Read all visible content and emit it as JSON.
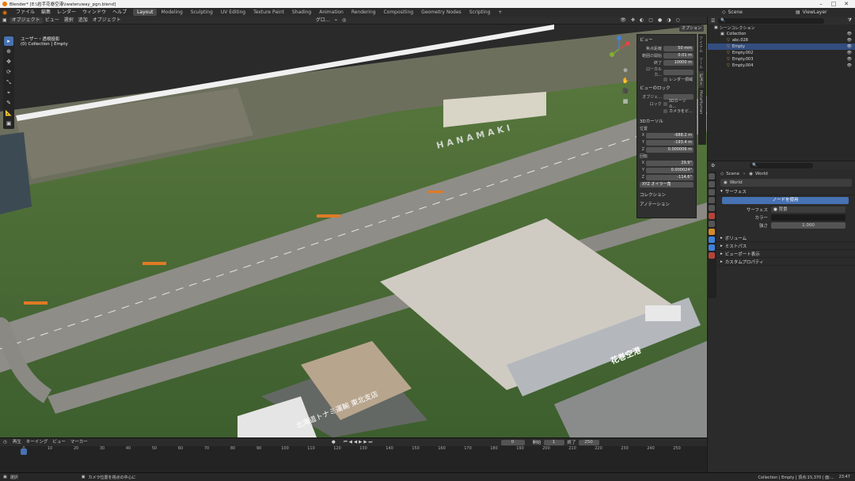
{
  "window": {
    "title": "Blender* [E:\\岩手花巻空港\\iwateruway_pgn.blend]"
  },
  "topmenu": [
    "ファイル",
    "編集",
    "レンダー",
    "ウィンドウ",
    "ヘルプ"
  ],
  "workspaces": [
    "Layout",
    "Modeling",
    "Sculpting",
    "UV Editing",
    "Texture Paint",
    "Shading",
    "Animation",
    "Rendering",
    "Compositing",
    "Geometry Nodes",
    "Scripting"
  ],
  "workspace_add": "+",
  "scene_name": "Scene",
  "view_layer": "ViewLayer",
  "viewport_header": {
    "mode": "オブジェクト",
    "menus": [
      "ビュー",
      "選択",
      "追加",
      "オブジェクト"
    ],
    "transform": "グロ...",
    "options": "オプション"
  },
  "viewport": {
    "view_name": "ユーザー・透視投影",
    "collection_info": "(0) Collection | Empty",
    "map_label_runway": "HANAMAKI",
    "map_label_bldg": "北海道トナミ運輸 東北支店",
    "map_label_terminal": "花巻空港"
  },
  "npanel": {
    "tabs": [
      "アイテム",
      "ツール",
      "ビュー",
      "MetaHuman"
    ],
    "view_section": "ビュー",
    "focal_label": "焦点距離",
    "focal_value": "50 mm",
    "clip_start_label": "範囲の開始",
    "clip_start_value": "0.01 m",
    "clip_end_label": "終了",
    "clip_end_value": "10000 m",
    "local_camera_label": "ローカルカ...",
    "render_region_label": "レンダー領域",
    "view_lock_section": "ビューのロック",
    "lock_object_label": "オブジェ...",
    "lock_label": "ロック",
    "lock_cursor": "3Dカーソル...",
    "lock_camera": "カメラをビ...",
    "cursor_section": "3Dカーソル",
    "location_label": "位置",
    "loc_x": "-688.2 m",
    "loc_y": "-193.4 m",
    "loc_z": "0.000006 m",
    "rotation_label": "回転",
    "rot_x": "29.9°",
    "rot_y": "0.000024°",
    "rot_z": "-114.6°",
    "euler": "XYZ オイラー角",
    "collection_section": "コレクション",
    "annotation_section": "アノテーション"
  },
  "outliner": {
    "root": "シーンコレクション",
    "items": [
      {
        "name": "Collection",
        "level": 1,
        "selected": false
      },
      {
        "name": "abc.028",
        "level": 2,
        "selected": false
      },
      {
        "name": "Empty",
        "level": 2,
        "selected": true
      },
      {
        "name": "Empty.002",
        "level": 2,
        "selected": false
      },
      {
        "name": "Empty.003",
        "level": 2,
        "selected": false
      },
      {
        "name": "Empty.004",
        "level": 2,
        "selected": false
      }
    ]
  },
  "properties": {
    "breadcrumb_scene": "Scene",
    "breadcrumb_world": "World",
    "world_name": "World",
    "surface_section": "サーフェス",
    "use_nodes_button": "ノードを使用",
    "surface_label": "サーフェス",
    "surface_value": "背景",
    "color_label": "カラー",
    "strength_label": "強さ",
    "strength_value": "1.000",
    "sections": [
      "ボリューム",
      "ミストパス",
      "ビューポート表示",
      "カスタムプロパティ"
    ]
  },
  "timeline": {
    "menus": [
      "再生",
      "キーイング",
      "ビュー",
      "マーカー"
    ],
    "current_frame": "0",
    "start_label": "開始",
    "start_value": "1",
    "end_label": "終了",
    "end_value": "250",
    "ticks": [
      "0",
      "10",
      "20",
      "30",
      "40",
      "50",
      "60",
      "70",
      "80",
      "90",
      "100",
      "110",
      "120",
      "130",
      "140",
      "150",
      "160",
      "170",
      "180",
      "190",
      "200",
      "210",
      "220",
      "230",
      "240",
      "250"
    ]
  },
  "statusbar": {
    "left": "選択",
    "middle": "カメラ位置を視点の中心に",
    "right": "Collection | Empty | 頂点:15,370 | 面:...",
    "clock": "23:47"
  },
  "colors": {
    "accent": "#4772b3",
    "orange": "#e87d0d",
    "selected_row": "#334d80"
  }
}
